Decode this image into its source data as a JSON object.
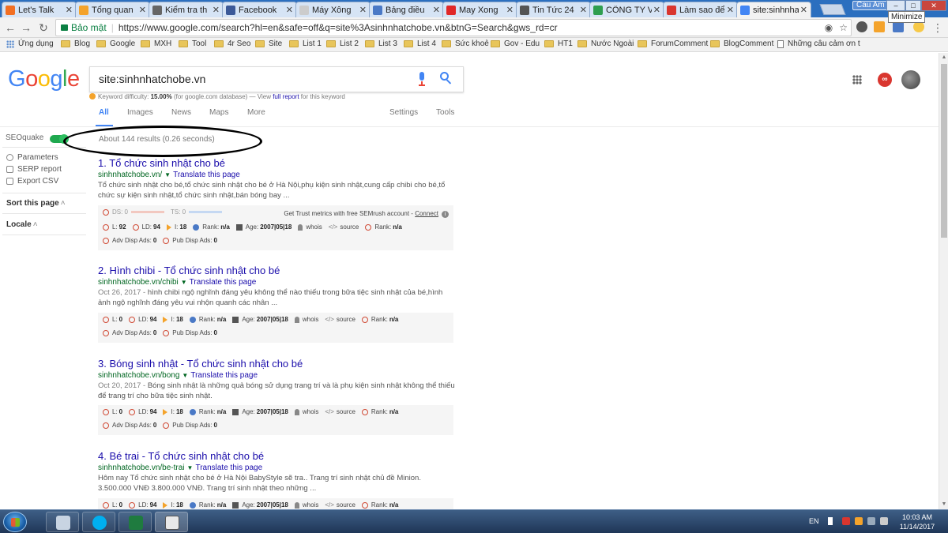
{
  "browser": {
    "tabs": [
      {
        "label": "Let's Talk",
        "icon": "soundcloud-icon",
        "color": "#f26f23"
      },
      {
        "label": "Tổng quan",
        "icon": "analytics-icon",
        "color": "#f4a32b"
      },
      {
        "label": "Kiểm tra th",
        "icon": "seo-tool-icon",
        "color": "#666666"
      },
      {
        "label": "Facebook",
        "icon": "facebook-icon",
        "color": "#3b5998"
      },
      {
        "label": "Máy Xông",
        "icon": "page-icon",
        "color": "#cccccc"
      },
      {
        "label": "Bảng điều",
        "icon": "dashboard-icon",
        "color": "#4a79c6"
      },
      {
        "label": "May Xong",
        "icon": "flipboard-icon",
        "color": "#e12828"
      },
      {
        "label": "Tin Tức 24",
        "icon": "t-icon",
        "color": "#555555"
      },
      {
        "label": "CÔNG TY V",
        "icon": "globe-icon",
        "color": "#2e9e4f"
      },
      {
        "label": "Làm sao để",
        "icon": "idv-icon",
        "color": "#d9362f"
      },
      {
        "label": "site:sinhnha",
        "icon": "google-icon",
        "color": "#4285f4"
      }
    ],
    "profile_name": "Cau Am",
    "tooltip": "Minimize",
    "security_label": "Bảo mật",
    "url": "https://www.google.com/search?hl=en&safe=off&q=site%3Asinhnhatchobe.vn&btnG=Search&gws_rd=cr"
  },
  "bookmarks": [
    {
      "label": "Ứng dụng",
      "type": "apps"
    },
    {
      "label": "Blog",
      "type": "folder"
    },
    {
      "label": "Google",
      "type": "folder"
    },
    {
      "label": "MXH",
      "type": "folder"
    },
    {
      "label": "Tool",
      "type": "folder"
    },
    {
      "label": "4r Seo",
      "type": "folder"
    },
    {
      "label": "Site",
      "type": "folder"
    },
    {
      "label": "List 1",
      "type": "folder"
    },
    {
      "label": "List 2",
      "type": "folder"
    },
    {
      "label": "List 3",
      "type": "folder"
    },
    {
      "label": "List 4",
      "type": "folder"
    },
    {
      "label": "Sức khoẻ",
      "type": "folder"
    },
    {
      "label": "Gov - Edu",
      "type": "folder"
    },
    {
      "label": "HT1",
      "type": "folder"
    },
    {
      "label": "Nước Ngoài",
      "type": "folder"
    },
    {
      "label": "ForumComment",
      "type": "folder"
    },
    {
      "label": "BlogComment",
      "type": "folder"
    },
    {
      "label": "Những câu cảm ơn t",
      "type": "page"
    }
  ],
  "google": {
    "logo_letters": [
      {
        "ch": "G",
        "color": "#4285f4"
      },
      {
        "ch": "o",
        "color": "#ea4335"
      },
      {
        "ch": "o",
        "color": "#fbbc05"
      },
      {
        "ch": "g",
        "color": "#4285f4"
      },
      {
        "ch": "l",
        "color": "#34a853"
      },
      {
        "ch": "e",
        "color": "#ea4335"
      }
    ],
    "query": "site:sinhnhatchobe.vn",
    "keyword_difficulty": {
      "label": "Keyword difficulty:",
      "value": "15.00%",
      "note": "(for google.com database) — View",
      "link": "full report",
      "tail": "for this keyword"
    },
    "tabs": [
      "All",
      "Images",
      "News",
      "Maps",
      "More"
    ],
    "right_tabs": [
      "Settings",
      "Tools"
    ],
    "result_stats": "About 144 results (0.26 seconds)"
  },
  "seoquake_sidebar": {
    "title": "SEOquake",
    "items": [
      "Parameters",
      "SERP report",
      "Export CSV"
    ],
    "sections": [
      "Sort this page",
      "Locale"
    ]
  },
  "results": [
    {
      "title": "1. Tổ chức sinh nhật cho bé",
      "url": "sinhnhatchobe.vn/",
      "translate": "Translate this page",
      "date": "",
      "snippet": "Tổ chức sinh nhật cho bé,tổ chức sinh nhật cho bé ở Hà Nội,phụ kiện sinh nhật,cung cấp chibi cho bé,tổ chức sự kiện sinh nhật,tổ chức sinh nhật,bán bóng bay ...",
      "metrics": {
        "L": "92",
        "LD": "94",
        "I": "18",
        "Rank": "n/a",
        "Age": "2007|05|18",
        "whois": "whois",
        "source": "source",
        "Rank2": "n/a",
        "AdvDispAds": "0",
        "PubDispAds": "0"
      }
    },
    {
      "title": "2. Hình chibi - Tổ chức sinh nhật cho bé",
      "url": "sinhnhatchobe.vn/chibi",
      "translate": "Translate this page",
      "date": "Oct 26, 2017 - ",
      "snippet": "hình chibi ngộ nghĩnh đáng yêu không thể nào thiếu trong bữa tiệc sinh nhật của bé,hình ảnh ngộ nghĩnh đáng yêu vui nhộn quanh các nhân ...",
      "metrics": {
        "L": "0",
        "LD": "94",
        "I": "18",
        "Rank": "n/a",
        "Age": "2007|05|18",
        "whois": "whois",
        "source": "source",
        "Rank2": "n/a",
        "AdvDispAds": "0",
        "PubDispAds": "0"
      }
    },
    {
      "title": "3. Bóng sinh nhật - Tổ chức sinh nhật cho bé",
      "url": "sinhnhatchobe.vn/bong",
      "translate": "Translate this page",
      "date": "Oct 20, 2017 - ",
      "snippet": "Bóng sinh nhật là những quả bóng sử dụng trang trí và là phụ kiện sinh nhật không thể thiếu để trang trí cho bữa tiệc sinh nhật.",
      "metrics": {
        "L": "0",
        "LD": "94",
        "I": "18",
        "Rank": "n/a",
        "Age": "2007|05|18",
        "whois": "whois",
        "source": "source",
        "Rank2": "n/a",
        "AdvDispAds": "0",
        "PubDispAds": "0"
      }
    },
    {
      "title": "4. Bé trai - Tổ chức sinh nhật cho bé",
      "url": "sinhnhatchobe.vn/be-trai",
      "translate": "Translate this page",
      "date": "",
      "snippet": "Hôm nay Tổ chức sinh nhật cho bé ở Hà Nội BabyStyle sẽ tra.. Trang trí sinh nhật chủ đề Minion. 3.500.000 VNĐ 3.800.000 VNĐ. Trang trí sinh nhật theo những ...",
      "metrics": {
        "L": "0",
        "LD": "94",
        "I": "18",
        "Rank": "n/a",
        "Age": "2007|05|18",
        "whois": "whois",
        "source": "source",
        "Rank2": "n/a",
        "AdvDispAds": "",
        "PubDispAds": ""
      }
    }
  ],
  "first_result_trust": {
    "ds": "DS: 0",
    "ts": "TS: 0",
    "text": "Get Trust metrics with free SEMrush account -",
    "link": "Connect"
  },
  "metric_labels": {
    "L": "L:",
    "LD": "LD:",
    "I": "I:",
    "Rank": "Rank:",
    "Age": "Age:",
    "Adv": "Adv Disp Ads:",
    "Pub": "Pub Disp Ads:"
  },
  "taskbar": {
    "lang": "EN",
    "time": "10:03 AM",
    "date": "11/14/2017"
  }
}
